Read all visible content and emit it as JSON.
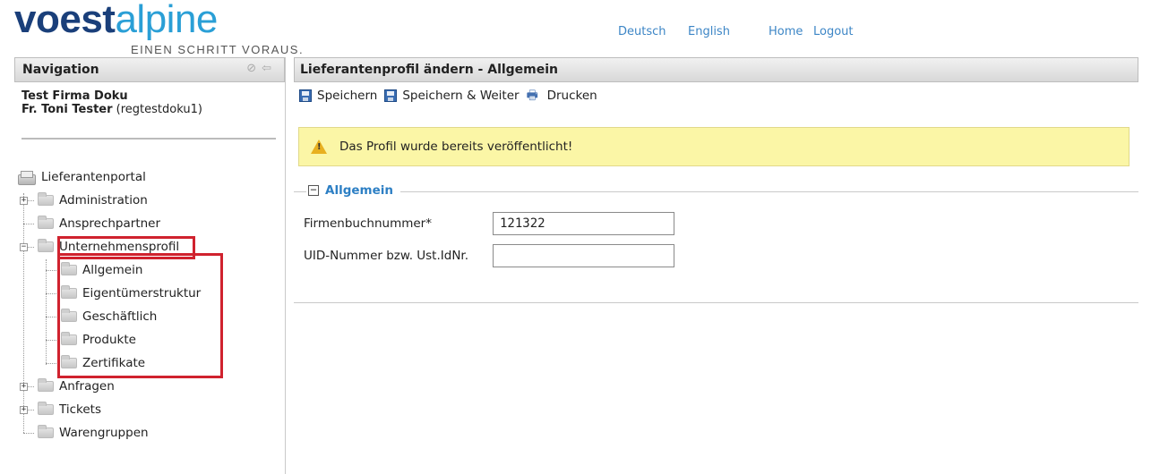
{
  "brand": {
    "logo_dark": "voest",
    "logo_light": "alpine",
    "tagline": "EINEN SCHRITT VORAUS."
  },
  "toplinks": {
    "deutsch": "Deutsch",
    "english": "English",
    "home": "Home",
    "logout": "Logout"
  },
  "nav": {
    "title": "Navigation",
    "company": "Test Firma Doku",
    "user_name": "Fr. Toni Tester",
    "user_id": "(regtestdoku1)",
    "root": "Lieferantenportal",
    "items": [
      {
        "label": "Administration"
      },
      {
        "label": "Ansprechpartner"
      },
      {
        "label": "Unternehmensprofil"
      },
      {
        "label": "Allgemein"
      },
      {
        "label": "Eigentümerstruktur"
      },
      {
        "label": "Geschäftlich"
      },
      {
        "label": "Produkte"
      },
      {
        "label": "Zertifikate"
      },
      {
        "label": "Anfragen"
      },
      {
        "label": "Tickets"
      },
      {
        "label": "Warengruppen"
      }
    ],
    "highlight_color": "#d0222e"
  },
  "main": {
    "title": "Lieferantenprofil ändern - Allgemein",
    "toolbar": {
      "save": "Speichern",
      "save_next": "Speichern & Weiter",
      "print": "Drucken"
    },
    "warning": "Das Profil wurde bereits veröffentlicht!",
    "section": {
      "title": "Allgemein",
      "fields": [
        {
          "label": "Firmenbuchnummer*",
          "value": "121322"
        },
        {
          "label": "UID-Nummer bzw. Ust.IdNr.",
          "value": ""
        }
      ]
    }
  },
  "colors": {
    "link": "#3d86c6",
    "section_title": "#2d7fc4",
    "warning_bg": "#fbf6a6",
    "logo_dark": "#1a3f7a",
    "logo_light": "#2a9fd6"
  }
}
